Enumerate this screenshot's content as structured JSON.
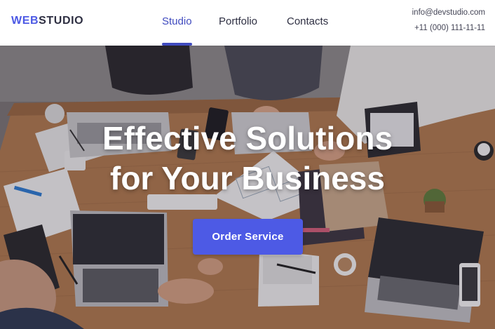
{
  "header": {
    "logo": {
      "part1": "WEB",
      "part2": "STUDIO"
    },
    "nav": [
      {
        "label": "Studio",
        "active": true
      },
      {
        "label": "Portfolio",
        "active": false
      },
      {
        "label": "Contacts",
        "active": false
      }
    ],
    "contacts": {
      "email": "info@devstudio.com",
      "phone": "+11 (000) 111-11-11"
    }
  },
  "hero": {
    "title_line1": "Effective Solutions",
    "title_line2": "for Your Business",
    "button_label": "Order Service",
    "background": "photo-of-people-working-with-laptops-on-wooden-table"
  },
  "colors": {
    "accent": "#4d5ae5",
    "active_nav": "#404bbf",
    "text_dark": "#2e2f42",
    "text_muted": "#434455"
  }
}
